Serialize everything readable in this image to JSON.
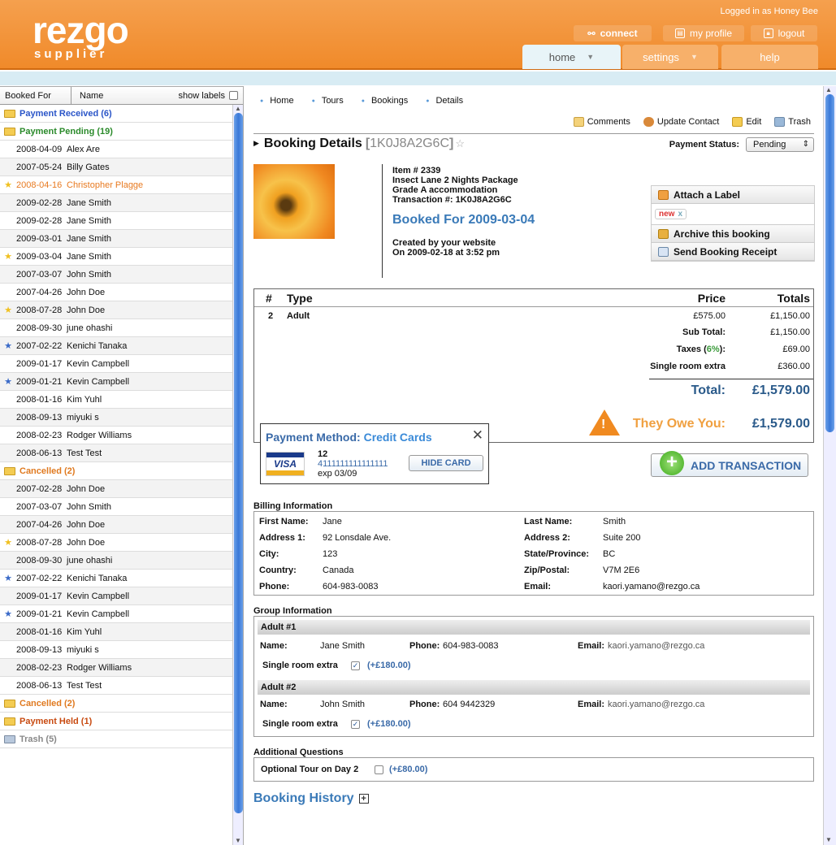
{
  "header": {
    "logo": "rezgo",
    "logo_sub": "supplier",
    "logged_in": "Logged in as Honey Bee",
    "connect": "connect",
    "my_profile": "my profile",
    "logout": "logout",
    "tabs": [
      "home",
      "settings",
      "help"
    ]
  },
  "sidebar": {
    "col1": "Booked For",
    "col2": "Name",
    "show_labels": "show labels",
    "rows": [
      {
        "t": "g",
        "label": "Payment Received (6)",
        "color": "#2a55c8",
        "icon": "folder"
      },
      {
        "t": "g",
        "label": "Payment Pending (19)",
        "color": "#2a8a2a",
        "icon": "folder"
      },
      {
        "d": "2008-04-09",
        "n": "Alex Are"
      },
      {
        "d": "2007-05-24",
        "n": "Billy Gates"
      },
      {
        "d": "2008-04-16",
        "n": "Christopher Plagge",
        "color": "#e87a20",
        "icon": "star-yellow"
      },
      {
        "d": "2009-02-28",
        "n": "Jane Smith"
      },
      {
        "d": "2009-02-28",
        "n": "Jane Smith"
      },
      {
        "d": "2009-03-01",
        "n": "Jane Smith"
      },
      {
        "d": "2009-03-04",
        "n": "Jane Smith",
        "icon": "star-yellow"
      },
      {
        "d": "2007-03-07",
        "n": "John Smith"
      },
      {
        "d": "2007-04-26",
        "n": "John Doe"
      },
      {
        "d": "2008-07-28",
        "n": "John Doe",
        "icon": "star-yellow"
      },
      {
        "d": "2008-09-30",
        "n": "june ohashi"
      },
      {
        "d": "2007-02-22",
        "n": "Kenichi Tanaka",
        "icon": "star-blue"
      },
      {
        "d": "2009-01-17",
        "n": "Kevin Campbell"
      },
      {
        "d": "2009-01-21",
        "n": "Kevin Campbell",
        "icon": "star-blue"
      },
      {
        "d": "2008-01-16",
        "n": "Kim Yuhl"
      },
      {
        "d": "2008-09-13",
        "n": "miyuki s"
      },
      {
        "d": "2008-02-23",
        "n": "Rodger Williams"
      },
      {
        "d": "2008-06-13",
        "n": "Test Test"
      },
      {
        "t": "g",
        "label": "Cancelled (2)",
        "color": "#e07a20",
        "icon": "folder"
      },
      {
        "d": "2007-02-28",
        "n": "John Doe"
      },
      {
        "d": "2007-03-07",
        "n": "John Smith"
      },
      {
        "d": "2007-04-26",
        "n": "John Doe"
      },
      {
        "d": "2008-07-28",
        "n": "John Doe",
        "icon": "star-yellow"
      },
      {
        "d": "2008-09-30",
        "n": "june ohashi"
      },
      {
        "d": "2007-02-22",
        "n": "Kenichi Tanaka",
        "icon": "star-blue"
      },
      {
        "d": "2009-01-17",
        "n": "Kevin Campbell"
      },
      {
        "d": "2009-01-21",
        "n": "Kevin Campbell",
        "icon": "star-blue"
      },
      {
        "d": "2008-01-16",
        "n": "Kim Yuhl"
      },
      {
        "d": "2008-09-13",
        "n": "miyuki s"
      },
      {
        "d": "2008-02-23",
        "n": "Rodger Williams"
      },
      {
        "d": "2008-06-13",
        "n": "Test Test"
      },
      {
        "t": "g",
        "label": "Cancelled (2)",
        "color": "#e07a20",
        "icon": "folder"
      },
      {
        "t": "g",
        "label": "Payment Held (1)",
        "color": "#c84a10",
        "icon": "folder"
      },
      {
        "t": "g",
        "label": "Trash (5)",
        "color": "#888888",
        "icon": "trash"
      }
    ]
  },
  "breadcrumbs": [
    "Home",
    "Tours",
    "Bookings",
    "Details"
  ],
  "actions": [
    "Comments",
    "Update Contact",
    "Edit",
    "Trash"
  ],
  "booking": {
    "title": "Booking Details",
    "code_open": "[",
    "code": "1K0J8A2G6C",
    "code_close": "]",
    "payment_status_label": "Payment Status:",
    "payment_status": "Pending",
    "item": "Item # 2339",
    "package": "Insect Lane 2 Nights Package",
    "accommodation": "Grade A accommodation",
    "transaction": "Transaction #: 1K0J8A2G6C",
    "booked_for": "Booked For 2009-03-04",
    "created_by": "Created by your website",
    "created_on": "On 2009-02-18 at 3:52 pm"
  },
  "label_box": {
    "attach": "Attach a Label",
    "tag": "new",
    "tag_x": "x",
    "archive": "Archive this booking",
    "send": "Send Booking Receipt"
  },
  "pricing": {
    "h_num": "#",
    "h_type": "Type",
    "h_price": "Price",
    "h_totals": "Totals",
    "qty": "2",
    "type": "Adult",
    "price": "£575.00",
    "line_total": "£1,150.00",
    "subtotal_label": "Sub Total:",
    "subtotal": "£1,150.00",
    "taxes_label": "Taxes (",
    "taxes_pct": "6%",
    "taxes_close": "):",
    "taxes": "£69.00",
    "single_label": "Single room extra",
    "single": "£360.00",
    "total_label": "Total:",
    "total": "£1,579.00",
    "owe_label": "They Owe You:",
    "owe": "£1,579.00"
  },
  "payment": {
    "label": "Payment Method:",
    "method": "Credit Cards",
    "close": "✕",
    "card_brand": "VISA",
    "card_num": "12",
    "card_full": "4111111111111111",
    "exp": "exp 03/09",
    "hide": "HIDE CARD"
  },
  "add_tx": "ADD TRANSACTION",
  "billing": {
    "title": "Billing Information",
    "first_l": "First Name:",
    "first": "Jane",
    "last_l": "Last Name:",
    "last": "Smith",
    "a1_l": "Address 1:",
    "a1": "92 Lonsdale Ave.",
    "a2_l": "Address 2:",
    "a2": "Suite 200",
    "city_l": "City:",
    "city": "123",
    "state_l": "State/Province:",
    "state": "BC",
    "country_l": "Country:",
    "country": "Canada",
    "zip_l": "Zip/Postal:",
    "zip": "V7M 2E6",
    "phone_l": "Phone:",
    "phone": "604-983-0083",
    "email_l": "Email:",
    "email": "kaori.yamano@rezgo.ca"
  },
  "group": {
    "title": "Group Information",
    "name_l": "Name:",
    "phone_l": "Phone:",
    "email_l": "Email:",
    "single_l": "Single room extra",
    "check": "✓",
    "adults": [
      {
        "h": "Adult #1",
        "name": "Jane Smith",
        "phone": "604-983-0083",
        "email": "kaori.yamano@rezgo.ca",
        "extra": "(+£180.00)"
      },
      {
        "h": "Adult #2",
        "name": "John Smith",
        "phone": "604 9442329",
        "email": "kaori.yamano@rezgo.ca",
        "extra": "(+£180.00)"
      }
    ]
  },
  "questions": {
    "title": "Additional Questions",
    "q": "Optional Tour on Day 2",
    "extra": "(+£80.00)"
  },
  "history": {
    "title": "Booking History",
    "toggle": "+"
  }
}
